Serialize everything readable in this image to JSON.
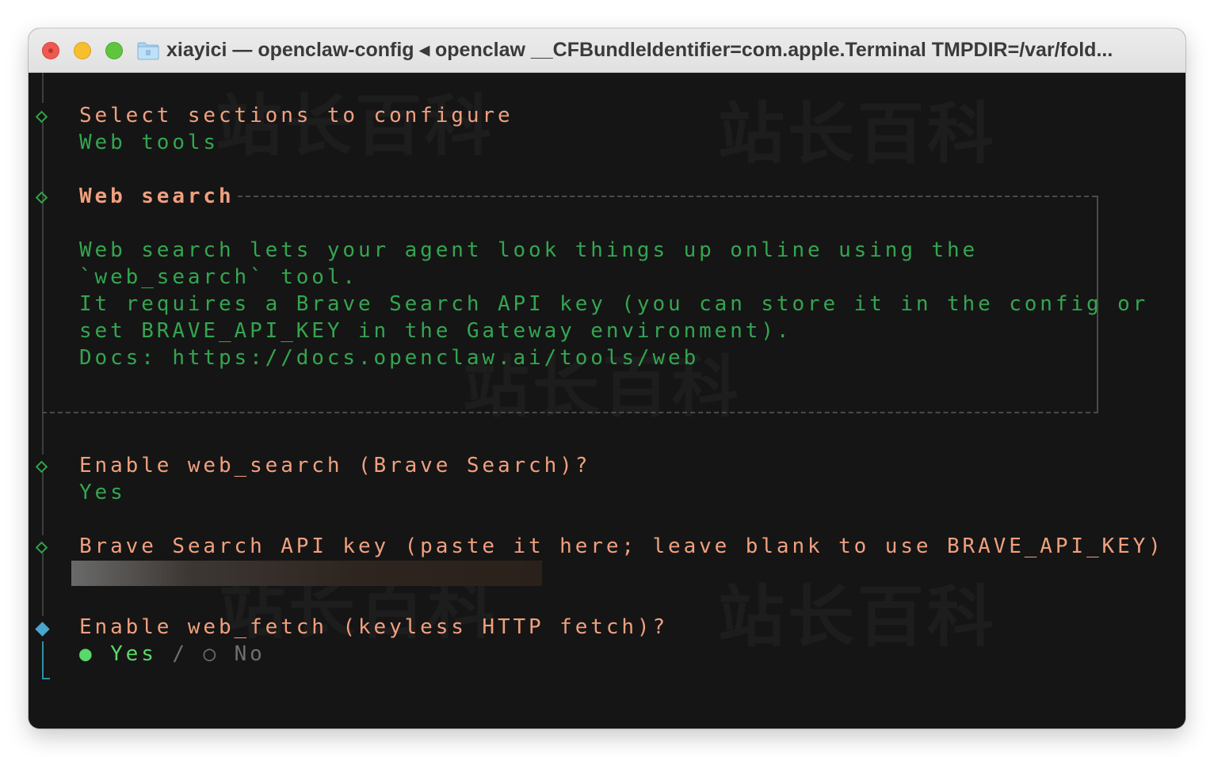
{
  "window": {
    "title": "xiayici — openclaw-config ◂ openclaw __CFBundleIdentifier=com.apple.Terminal TMPDIR=/var/fold...",
    "traffic_lights": [
      "close",
      "minimize",
      "zoom"
    ]
  },
  "watermark": "站长百科",
  "terminal": {
    "sections_prompt": "Select sections to configure",
    "sections_answer": "Web tools",
    "web_search_header": "Web search",
    "info_lines": [
      "Web search lets your agent look things up online using the",
      "`web_search` tool.",
      "It requires a Brave Search API key (you can store it in the config or",
      "set BRAVE_API_KEY in the Gateway environment).",
      "Docs: https://docs.openclaw.ai/tools/web"
    ],
    "enable_search_prompt": "Enable web_search (Brave Search)?",
    "enable_search_answer": "Yes",
    "api_key_prompt": "Brave Search API key (paste it here; leave blank to use BRAVE_API_KEY)",
    "enable_fetch_prompt": "Enable web_fetch (keyless HTTP fetch)?",
    "fetch_options": {
      "selected_marker": "●",
      "yes": "Yes",
      "separator": "/",
      "unselected_marker": "○",
      "no": "No"
    }
  },
  "colors": {
    "prompt": "#f0a07e",
    "answer": "#34a550",
    "selected": "#59d96a",
    "active_marker": "#4aa6cf"
  }
}
